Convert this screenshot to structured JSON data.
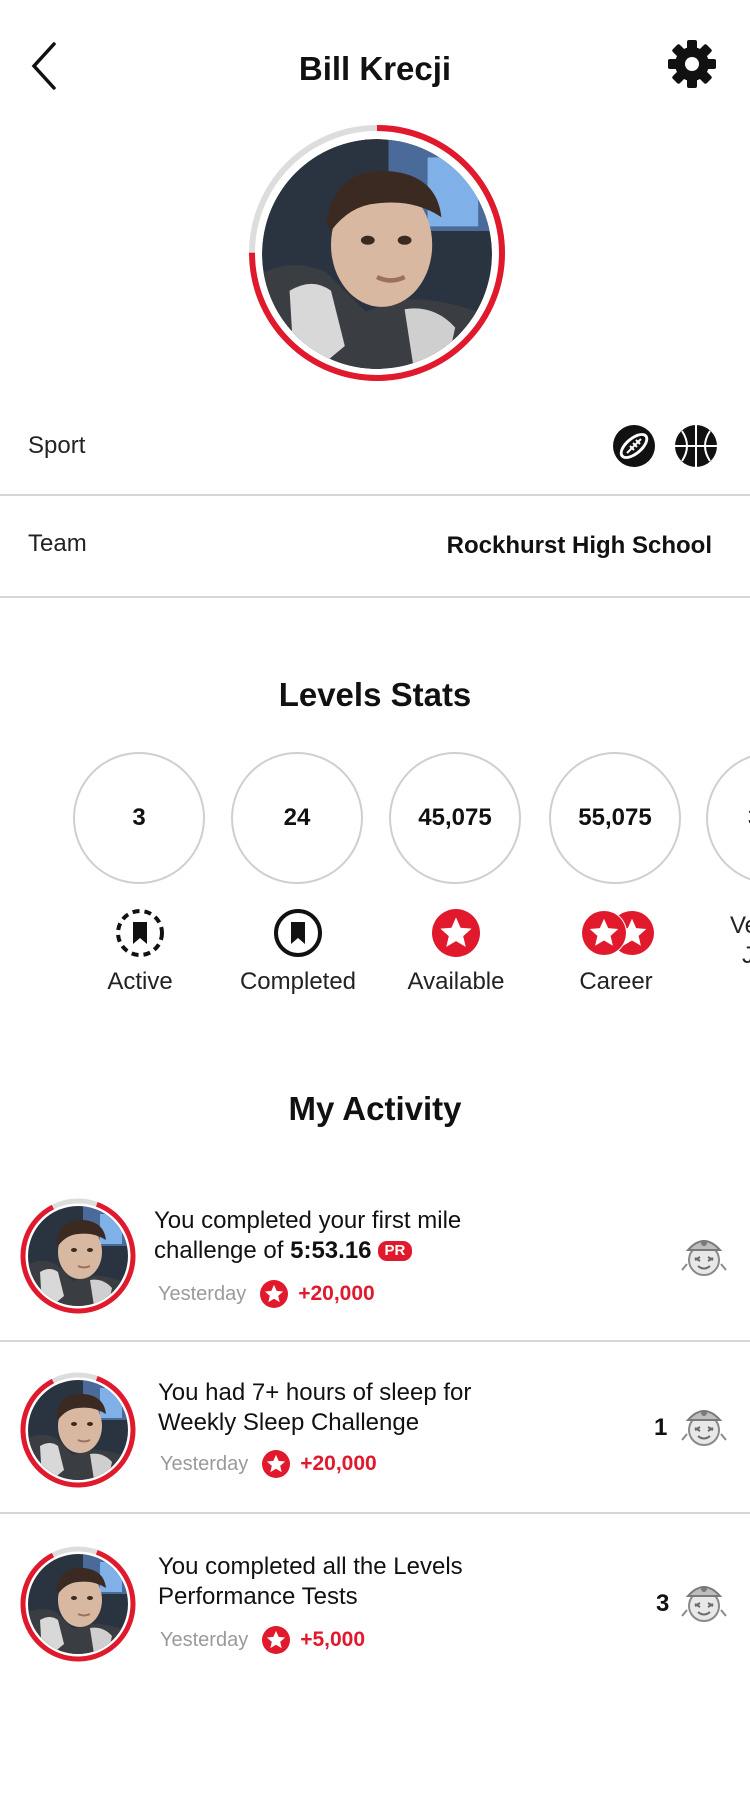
{
  "header": {
    "title": "Bill Krecji"
  },
  "profile": {
    "ring_progress": 0.75,
    "accent_color": "#e0192d"
  },
  "info": {
    "sport_label": "Sport",
    "sport_icons": [
      "football-icon",
      "basketball-icon"
    ],
    "team_label": "Team",
    "team_value": "Rockhurst High School"
  },
  "levels_stats": {
    "title": "Levels Stats",
    "items": [
      {
        "value": "3",
        "label": "Active",
        "icon": "active-bookmark-icon"
      },
      {
        "value": "24",
        "label": "Completed",
        "icon": "completed-bookmark-icon"
      },
      {
        "value": "45,075",
        "label": "Available",
        "icon": "star-icon"
      },
      {
        "value": "55,075",
        "label": "Career",
        "icon": "double-star-icon"
      },
      {
        "value": "3",
        "label": "Ve",
        "label2": "J",
        "icon": "partial"
      }
    ]
  },
  "activity": {
    "title": "My Activity",
    "items": [
      {
        "text1": "You completed your first mile",
        "text2": "challenge of ",
        "highlight": "5:53.16",
        "badge": "PR",
        "time": "Yesterday",
        "points": "+20,000",
        "count": ""
      },
      {
        "text1": "You had 7+ hours of sleep for",
        "text2": "Weekly Sleep Challenge",
        "time": "Yesterday",
        "points": "+20,000",
        "count": "1"
      },
      {
        "text1": "You completed all the Levels",
        "text2": "Performance Tests",
        "time": "Yesterday",
        "points": "+5,000",
        "count": "3"
      }
    ]
  }
}
